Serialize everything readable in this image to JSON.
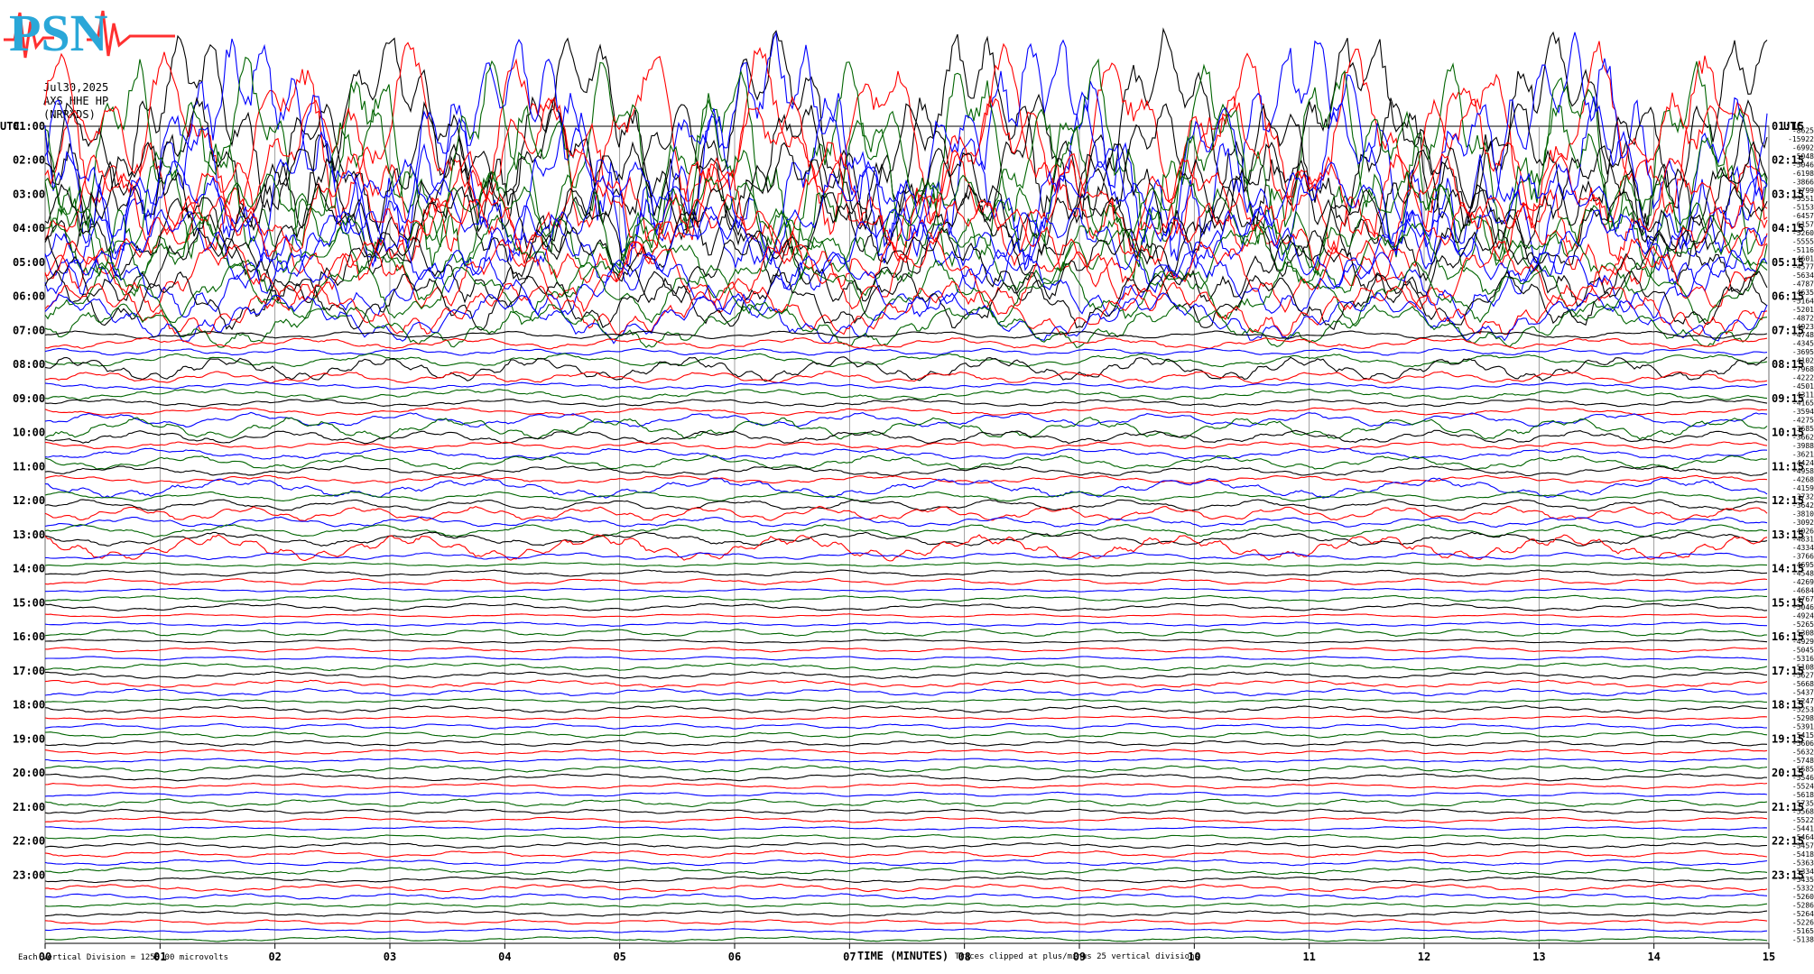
{
  "header": {
    "date": "Jul30,2025",
    "station": "AXS HHE HP",
    "network": "(NRRXDS)"
  },
  "utc_label_left": "UTC",
  "utc_label_right": "UTC",
  "footer": {
    "division_note": "Each Vertical Division = 1250.00 microvolts",
    "xlabel": "TIME (MINUTES)",
    "clip_note": "Traces clipped at plus/minus 25 vertical divisions"
  },
  "logo_text": "PSN",
  "chart_data": {
    "type": "line",
    "xlabel": "TIME (MINUTES)",
    "xlim": [
      0,
      15
    ],
    "x_ticks": [
      "00",
      "01",
      "02",
      "03",
      "04",
      "05",
      "06",
      "07",
      "08",
      "09",
      "10",
      "11",
      "12",
      "13",
      "14",
      "15"
    ],
    "left_hour_labels": [
      "01:00",
      "02:00",
      "03:00",
      "04:00",
      "05:00",
      "06:00",
      "07:00",
      "08:00",
      "09:00",
      "10:00",
      "11:00",
      "12:00",
      "13:00",
      "14:00",
      "15:00",
      "16:00",
      "17:00",
      "18:00",
      "19:00",
      "20:00",
      "21:00",
      "22:00",
      "23:00"
    ],
    "right_hour_labels": [
      "01:15",
      "02:15",
      "03:15",
      "04:15",
      "05:15",
      "06:15",
      "07:15",
      "08:15",
      "09:15",
      "10:15",
      "11:15",
      "12:15",
      "13:15",
      "14:15",
      "15:15",
      "16:15",
      "17:15",
      "18:15",
      "19:15",
      "20:15",
      "21:15",
      "22:15",
      "23:15"
    ],
    "trace_offsets": [
      "-8625",
      "-15922",
      "-6992",
      "-5048",
      "-5046",
      "-6198",
      "-3866",
      "-3799",
      "-5551",
      "-5153",
      "-6457",
      "-6157",
      "-5260",
      "-5555",
      "-5116",
      "-4601",
      "-4577",
      "-5634",
      "-4787",
      "-4635",
      "-5164",
      "-5201",
      "-4872",
      "-4923",
      "-4748",
      "-4345",
      "-3695",
      "-4102",
      "-7968",
      "-4222",
      "-4501",
      "-4311",
      "-4165",
      "-3594",
      "-4275",
      "-3685",
      "-3662",
      "-3988",
      "-3621",
      "-4424",
      "-4958",
      "-4268",
      "-4159",
      "-3732",
      "-3642",
      "-3810",
      "-3092",
      "-4026",
      "-4831",
      "-4334",
      "-3766",
      "-4695",
      "-4548",
      "-4269",
      "-4684",
      "-4767",
      "-5046",
      "-4924",
      "-5265",
      "-5308",
      "-4929",
      "-5045",
      "-5316",
      "-5108",
      "-5627",
      "-5668",
      "-5437",
      "-5247",
      "-5253",
      "-5298",
      "-5391",
      "-5415",
      "-5606",
      "-5632",
      "-5748",
      "-5585",
      "-5546",
      "-5524",
      "-5618",
      "-5735",
      "-5568",
      "-5522",
      "-5441",
      "-5464",
      "-5457",
      "-5418",
      "-5363",
      "-5334",
      "-5435",
      "-5332",
      "-5260",
      "-5286",
      "-5264",
      "-5226",
      "-5165",
      "-5138"
    ],
    "trace_colors": [
      "#000000",
      "#ff0000",
      "#0000ff",
      "#006400"
    ],
    "traces_per_hour": 4,
    "clipped": true,
    "grid": true
  }
}
